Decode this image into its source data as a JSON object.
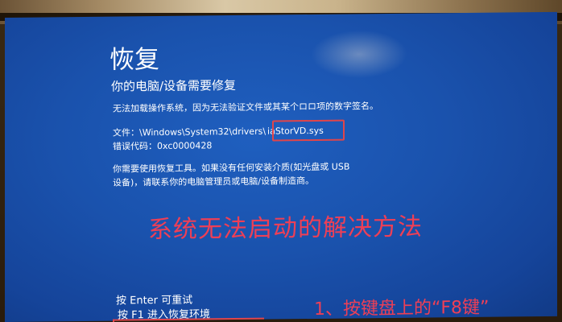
{
  "screen": {
    "title": "恢复",
    "subtitle": "你的电脑/设备需要修复",
    "line1": "无法加载操作系统，因为无法验证文件或其某个ロロ项的数字签名。",
    "file_label": "文件：",
    "file_path": "\\Windows\\System32\\drivers\\",
    "file_name": "iaStorVD.sys",
    "error_code": "错误代码：0xc0000428",
    "message_line1": "你需要使用恢复工具。如果没有任何安装介质(如光盘或 USB",
    "message_line2": "设备)，请联系你的电脑管理员或电脑/设备制造商。",
    "enter_option": "按 Enter 可重试",
    "f1_option": "按 F1 进入恢复环境"
  },
  "overlay": {
    "headline": "系统无法启动的解决方法",
    "step1": "1、按键盘上的“F8键”",
    "annotation_color": "#ee3f56"
  },
  "colors": {
    "screen_blue": "#1a52ad",
    "text": "#ffffff",
    "highlight_border": "#e0454a"
  }
}
